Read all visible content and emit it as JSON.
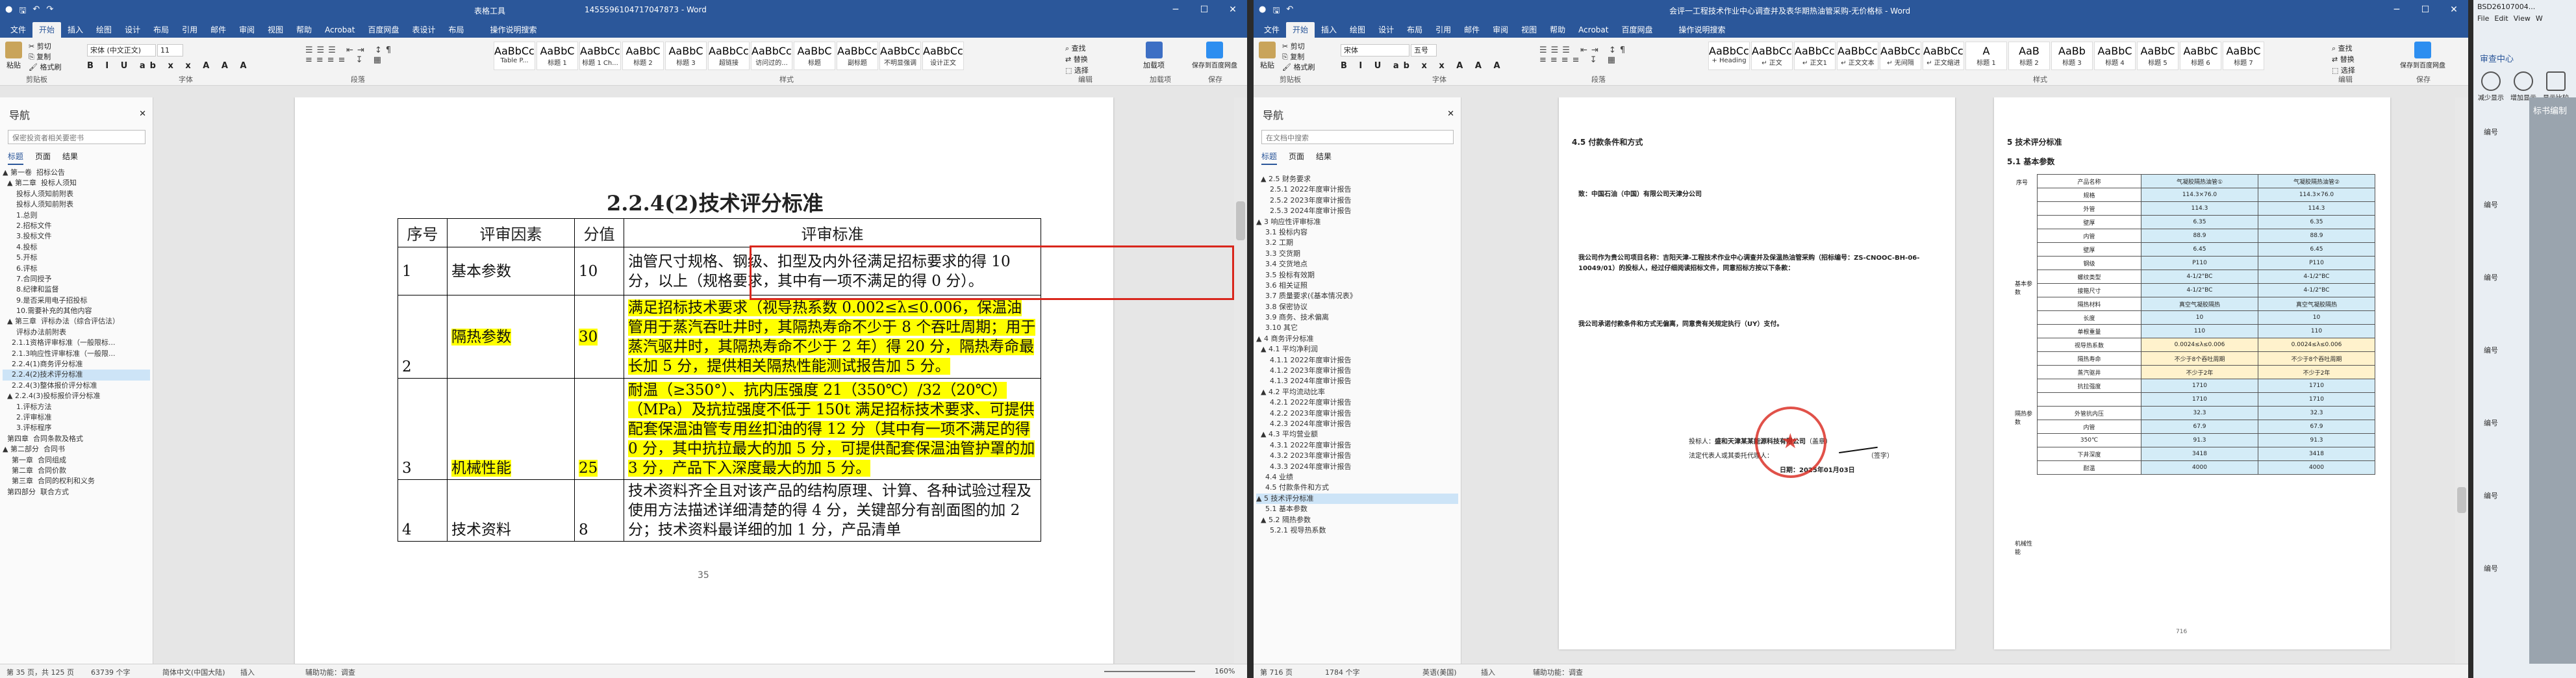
{
  "left": {
    "title": "1455596104717047873 - Word",
    "tools_title": "表格工具",
    "tabs": [
      "文件",
      "开始",
      "插入",
      "绘图",
      "设计",
      "布局",
      "引用",
      "邮件",
      "审阅",
      "视图",
      "帮助",
      "Acrobat",
      "百度网盘",
      "表设计",
      "布局"
    ],
    "tell_me": "操作说明搜索",
    "ribbon": {
      "paste": "粘贴",
      "cut": "剪切",
      "copy": "复制",
      "format_painter": "格式刷",
      "font_name": "宋体 (中文正文)",
      "font_size": "11",
      "groups": [
        "剪贴板",
        "字体",
        "段落",
        "样式",
        "编辑",
        "加载项",
        "保存"
      ],
      "styles": [
        {
          "preview": "AaBbCcD",
          "name": "Table P..."
        },
        {
          "preview": "AaBbC",
          "name": "标题 1"
        },
        {
          "preview": "AaBbCcD",
          "name": "标题 1 Ch..."
        },
        {
          "preview": "AaBbC",
          "name": "标题 2"
        },
        {
          "preview": "AaBbC",
          "name": "标题 3"
        },
        {
          "preview": "AaBbCcD",
          "name": "超链接"
        },
        {
          "preview": "AaBbCcD",
          "name": "访问过的..."
        },
        {
          "preview": "AaBbC",
          "name": "标题"
        },
        {
          "preview": "AaBbCcD",
          "name": "副标题"
        },
        {
          "preview": "AaBbCcD",
          "name": "不明显强调"
        },
        {
          "preview": "AaBbCcD",
          "name": "设计正文"
        }
      ],
      "find": "查找",
      "replace": "替换",
      "select": "选择",
      "addin": "加载项",
      "baidu_save": "保存到百度网盘"
    },
    "nav": {
      "title": "导航",
      "search": "保密投资者相关要密书",
      "tabs": [
        "标题",
        "页面",
        "结果"
      ],
      "items": [
        "▲ 第一卷  招标公告",
        "  ▲ 第二章  投标人须知",
        "      投标人须知前附表",
        "      投标人须知前附表",
        "      1.总则",
        "      2.招标文件",
        "      3.投标文件",
        "      4.投标",
        "      5.开标",
        "      6.评标",
        "      7.合同授予",
        "      8.纪律和监督",
        "      9.是否采用电子招投标",
        "      10.需要补充的其他内容",
        "  ▲ 第三章  评标办法（综合评估法）",
        "      评标办法前附表",
        "    2.1.1资格评审标准（一般限标...",
        "    2.1.3响应性评审标准（一般限...",
        "    2.2.4(1)商务评分标准",
        "    2.2.4(2)技术评分标准",
        "    2.2.4(3)整体报价评分标准",
        "  ▲ 2.2.4(3)投标报价评分标准",
        "      1.评标方法",
        "      2.评审标准",
        "      3.评标程序",
        "  第四章  合同条款及格式",
        "▲ 第二部分  合同书",
        "    第一章  合同组成",
        "    第二章  合同价款",
        "    第三章  合同的权利和义务",
        "  第四部分  联合方式"
      ]
    },
    "doc": {
      "heading": "2.2.4(2)技术评分标准",
      "columns": [
        "序号",
        "评审因素",
        "分值",
        "评审标准"
      ],
      "rows": [
        {
          "no": "1",
          "factor": "基本参数",
          "score": "10",
          "criteria": "油管尺寸规格、钢级、扣型及内外径满足招标要求的得 10 分，以上（规格要求，其中有一项不满足的得 0 分）。"
        },
        {
          "no": "2",
          "factor": "隔热参数",
          "score": "30",
          "criteria": "满足招标技术要求（视导热系数 0.002≤λ≤0.006，保温油管用于蒸汽吞吐井时，其隔热寿命不少于 8 个吞吐周期；用于蒸汽驱井时，其隔热寿命不少于 2 年）得 20 分，隔热寿命最长加 5 分，提供相关隔热性能测试报告加 5 分。"
        },
        {
          "no": "3",
          "factor": "机械性能",
          "score": "25",
          "criteria": "耐温（≥350°）、抗内压强度 21（350℃）/32（20℃）（MPa）及抗拉强度不低于 150t 满足招标技术要求、可提供配套保温油管专用丝扣油的得 12 分（其中有一项不满足的得 0 分，其中抗拉最大的加 5 分，可提供配套保温油管护罩的加 3 分，产品下入深度最大的加 5 分。"
        },
        {
          "no": "4",
          "factor": "技术资料",
          "score": "8",
          "criteria": "技术资料齐全且对该产品的结构原理、计算、各种试验过程及使用方法描述详细清楚的得 4 分，关键部分有剖面图的加 2 分；技术资料最详细的加 1 分，产品清单"
        }
      ],
      "page_number": "35"
    },
    "status": {
      "page": "第 35 页，共 125 页",
      "words": "63739 个字",
      "lang": "简体中文(中国大陆)",
      "insert": "插入",
      "mode": "辅助功能：调查",
      "zoom": "160%"
    }
  },
  "right": {
    "title": "会评一工程技术作业中心调查并及表华期热油管采购-无价格标 - Word",
    "tabs": [
      "文件",
      "开始",
      "插入",
      "绘图",
      "设计",
      "布局",
      "引用",
      "邮件",
      "审阅",
      "视图",
      "帮助",
      "Acrobat",
      "百度网盘"
    ],
    "tell_me": "操作说明搜索",
    "ribbon": {
      "paste": "粘贴",
      "cut": "剪切",
      "copy": "复制",
      "format_painter": "格式刷",
      "font_name": "宋体",
      "font_size": "五号",
      "groups": [
        "剪贴板",
        "字体",
        "段落",
        "样式",
        "编辑",
        "保存"
      ],
      "styles": [
        {
          "preview": "AaBbCcDd",
          "name": "+ Heading"
        },
        {
          "preview": "AaBbCcDd",
          "name": "↵ 正文"
        },
        {
          "preview": "AaBbCcDd",
          "name": "↵ 正文1"
        },
        {
          "preview": "AaBbCcDd",
          "name": "↵ 正文文本"
        },
        {
          "preview": "AaBbCcDd",
          "name": "↵ 无间隔"
        },
        {
          "preview": "AaBbCcD",
          "name": "↵ 正文缩进"
        },
        {
          "preview": "A",
          "name": "标题 1"
        },
        {
          "preview": "AaB",
          "name": "标题 2"
        },
        {
          "preview": "AaBb",
          "name": "标题 3"
        },
        {
          "preview": "AaBbC",
          "name": "标题 4"
        },
        {
          "preview": "AaBbC",
          "name": "标题 5"
        },
        {
          "preview": "AaBbC",
          "name": "标题 6"
        },
        {
          "preview": "AaBbC",
          "name": "标题 7"
        }
      ],
      "find": "查找",
      "replace": "替换",
      "select": "选择",
      "baidu_save": "保存到百度网盘"
    },
    "nav": {
      "title": "导航",
      "search": "在文档中搜索",
      "tabs": [
        "标题",
        "页面",
        "结果"
      ],
      "items": [
        "  ▲ 2.5 财务要求",
        "      2.5.1 2022年度审计报告",
        "      2.5.2 2023年度审计报告",
        "      2.5.3 2024年度审计报告",
        "▲ 3 响应性评审标准",
        "    3.1 投标内容",
        "    3.2 工期",
        "    3.3 交货期",
        "    3.4 交货地点",
        "    3.5 投标有效期",
        "    3.6 相关证照",
        "    3.7 质量要求(《基本情况表》",
        "    3.8 保密协议",
        "    3.9 商务、技术偏离",
        "    3.10 其它",
        "▲ 4 商务评分标准",
        "  ▲ 4.1 平均净利润",
        "      4.1.1 2022年度审计报告",
        "      4.1.2 2023年度审计报告",
        "      4.1.3 2024年度审计报告",
        "  ▲ 4.2 平均流动比率",
        "      4.2.1 2022年度审计报告",
        "      4.2.2 2023年度审计报告",
        "      4.2.3 2024年度审计报告",
        "  ▲ 4.3 平均营业额",
        "      4.3.1 2022年度审计报告",
        "      4.3.2 2023年度审计报告",
        "      4.3.3 2024年度审计报告",
        "    4.4 业绩",
        "    4.5 付款条件和方式",
        "▲ 5 技术评分标准",
        "    5.1 基本参数",
        "  ▲ 5.2 隔热参数",
        "      5.2.1 视导热系数"
      ]
    },
    "page1": {
      "heading": "4.5 付款条件和方式",
      "to_label": "致：中国石油（中国）有限公司天津分公司",
      "para1": "我公司作为贵公司项目名称：吉阳天津-工程技术作业中心调查并及保温热油管采购（招标编号：ZS-CNOOC-BH-06-10049/01）的投标人，经过仔细阅读招标文件，同意招标方按以下条款：",
      "para2": "我公司承诺付款条件和方式无偏离，同意贵有关规定执行（UY）支付。",
      "sign1": "投标人：",
      "company": "盛和天津某某能源科技有限公司",
      "stamp_note": "（盖章）",
      "sign2": "法定代表人或其委托代理人：",
      "sign2_note": "（签字）",
      "date": "日期：2025年01月03日"
    },
    "page2": {
      "heading": "5 技术评分标准",
      "sub": "5.1 基本参数",
      "side_labels": [
        "序号",
        "基本参数",
        "隔热参数",
        "机械性能"
      ],
      "col_headers": [
        "产品名称",
        "气凝胶隔热油管①",
        "气凝胶隔热油管②"
      ],
      "rows": [
        [
          "规格",
          "114.3×76.0",
          "114.3×76.0"
        ],
        [
          "外管",
          "114.3",
          "114.3"
        ],
        [
          "壁厚",
          "6.35",
          "6.35"
        ],
        [
          "内管",
          "88.9",
          "88.9"
        ],
        [
          "壁厚",
          "6.45",
          "6.45"
        ],
        [
          "钢级",
          "P110",
          "P110"
        ],
        [
          "螺纹类型",
          "4-1/2\"BC",
          "4-1/2\"BC"
        ],
        [
          "接箍尺寸",
          "4-1/2\"BC",
          "4-1/2\"BC"
        ],
        [
          "隔热材料",
          "真空气凝胶隔热",
          "真空气凝胶隔热"
        ],
        [
          "长度",
          "10",
          "10"
        ],
        [
          "单根重量",
          "110",
          "110"
        ],
        [
          "视导热系数",
          "0.0024≤λ≤0.006",
          "0.0024≤λ≤0.006"
        ],
        [
          "隔热寿命",
          "不少于8个吞吐周期",
          "不少于8个吞吐周期"
        ],
        [
          "蒸汽驱井",
          "不少于2年",
          "不少于2年"
        ],
        [
          "抗拉强度",
          "1710",
          "1710"
        ],
        [
          "",
          "1710",
          "1710"
        ],
        [
          "外管抗内压",
          "32.3",
          "32.3"
        ],
        [
          "内管",
          "67.9",
          "67.9"
        ],
        [
          "350℃",
          "91.3",
          "91.3"
        ],
        [
          "下井深度",
          "3418",
          "3418"
        ],
        [
          "耐温",
          "4000",
          "4000"
        ]
      ],
      "page_number": "716"
    },
    "status": {
      "page": "第 716 页",
      "words": "1784 个字",
      "lang": "英语(美国)",
      "insert": "插入",
      "mode": "辅助功能：调查"
    }
  },
  "far_right": {
    "title": "BSD26107004...",
    "menu": [
      "File",
      "Edit",
      "View",
      "W"
    ],
    "label": "审查中心",
    "buttons": [
      "减少显示",
      "增加显示",
      "显示比较"
    ],
    "sidebar_label": "标书编制",
    "items": [
      "编号",
      "编号",
      "编号",
      "编号",
      "编号",
      "编号",
      "编号"
    ]
  },
  "colors": {
    "word_blue": "#2b579a",
    "highlight": "#ffff00",
    "red_box": "#d9261c"
  }
}
